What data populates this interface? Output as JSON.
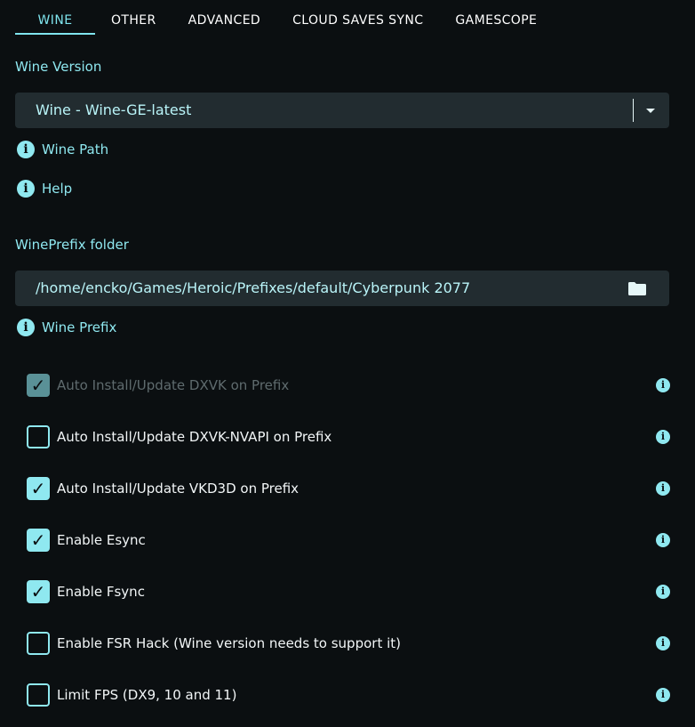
{
  "tabs": [
    {
      "label": "WINE",
      "active": true
    },
    {
      "label": "OTHER"
    },
    {
      "label": "ADVANCED"
    },
    {
      "label": "CLOUD SAVES SYNC"
    },
    {
      "label": "GAMESCOPE"
    }
  ],
  "wine_version": {
    "label": "Wine Version",
    "selected": "Wine - Wine-GE-latest"
  },
  "links": {
    "wine_path": "Wine Path",
    "help": "Help",
    "wine_prefix": "Wine Prefix"
  },
  "wineprefix": {
    "label": "WinePrefix folder",
    "value": "/home/encko/Games/Heroic/Prefixes/default/Cyberpunk 2077"
  },
  "options": [
    {
      "label": "Auto Install/Update DXVK on Prefix",
      "checked": true,
      "disabled": true
    },
    {
      "label": "Auto Install/Update DXVK-NVAPI on Prefix",
      "checked": false
    },
    {
      "label": "Auto Install/Update VKD3D on Prefix",
      "checked": true
    },
    {
      "label": "Enable Esync",
      "checked": true
    },
    {
      "label": "Enable Fsync",
      "checked": true
    },
    {
      "label": "Enable FSR Hack (Wine version needs to support it)",
      "checked": false
    },
    {
      "label": "Limit FPS (DX9, 10 and 11)",
      "checked": false
    }
  ],
  "colors": {
    "accent": "#8fe8f0",
    "background": "#0b0f11",
    "field": "#222c30"
  },
  "icons": {
    "info": "info-circle-icon",
    "folder": "folder-icon",
    "dropdown": "chevron-down-icon",
    "check": "checkmark-icon"
  }
}
